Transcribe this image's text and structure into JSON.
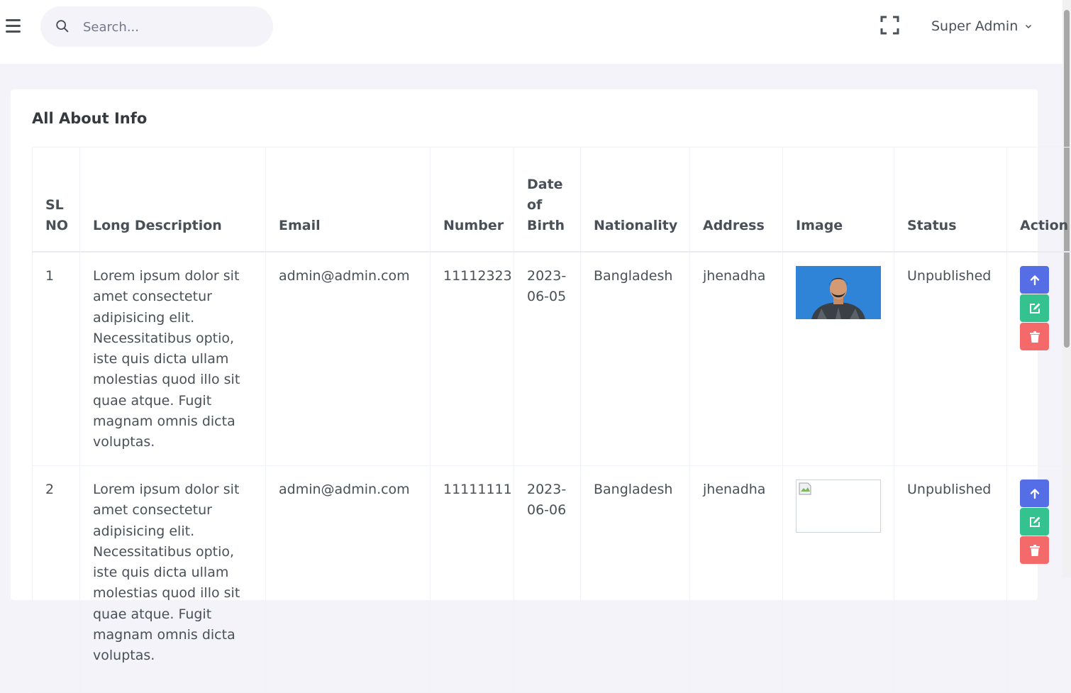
{
  "header": {
    "search_placeholder": "Search...",
    "user_name": "Super Admin"
  },
  "page": {
    "title": "All About Info"
  },
  "table": {
    "columns": [
      "SL NO",
      "Long Description",
      "Email",
      "Number",
      "Date of Birth",
      "Nationality",
      "Address",
      "Image",
      "Status",
      "Action"
    ],
    "rows": [
      {
        "sl": "1",
        "description": "Lorem ipsum dolor sit amet consectetur adipisicing elit. Necessitatibus optio, iste quis dicta ullam molestias quod illo sit quae atque. Fugit magnam omnis dicta voluptas.",
        "email": "admin@admin.com",
        "number": "11112323",
        "dob": "2023-06-05",
        "nationality": "Bangladesh",
        "address": "jhenadha",
        "image": "profile-photo",
        "status": "Unpublished"
      },
      {
        "sl": "2",
        "description": "Lorem ipsum dolor sit amet consectetur adipisicing elit. Necessitatibus optio, iste quis dicta ullam molestias quod illo sit quae atque. Fugit magnam omnis dicta voluptas.",
        "email": "admin@admin.com",
        "number": "11111111",
        "dob": "2023-06-06",
        "nationality": "Bangladesh",
        "address": "jhenadha",
        "image": "broken-image",
        "status": "Unpublished"
      }
    ]
  },
  "colors": {
    "primary": "#556ee6",
    "success": "#34c38f",
    "danger": "#f46a6a",
    "photo_bg": "#2a7fd4"
  },
  "icons": {
    "menu": "hamburger-icon",
    "search": "search-icon",
    "fullscreen": "fullscreen-icon",
    "dropdown": "chevron-down-icon",
    "publish": "arrow-up-icon",
    "edit": "edit-icon",
    "delete": "trash-icon"
  }
}
